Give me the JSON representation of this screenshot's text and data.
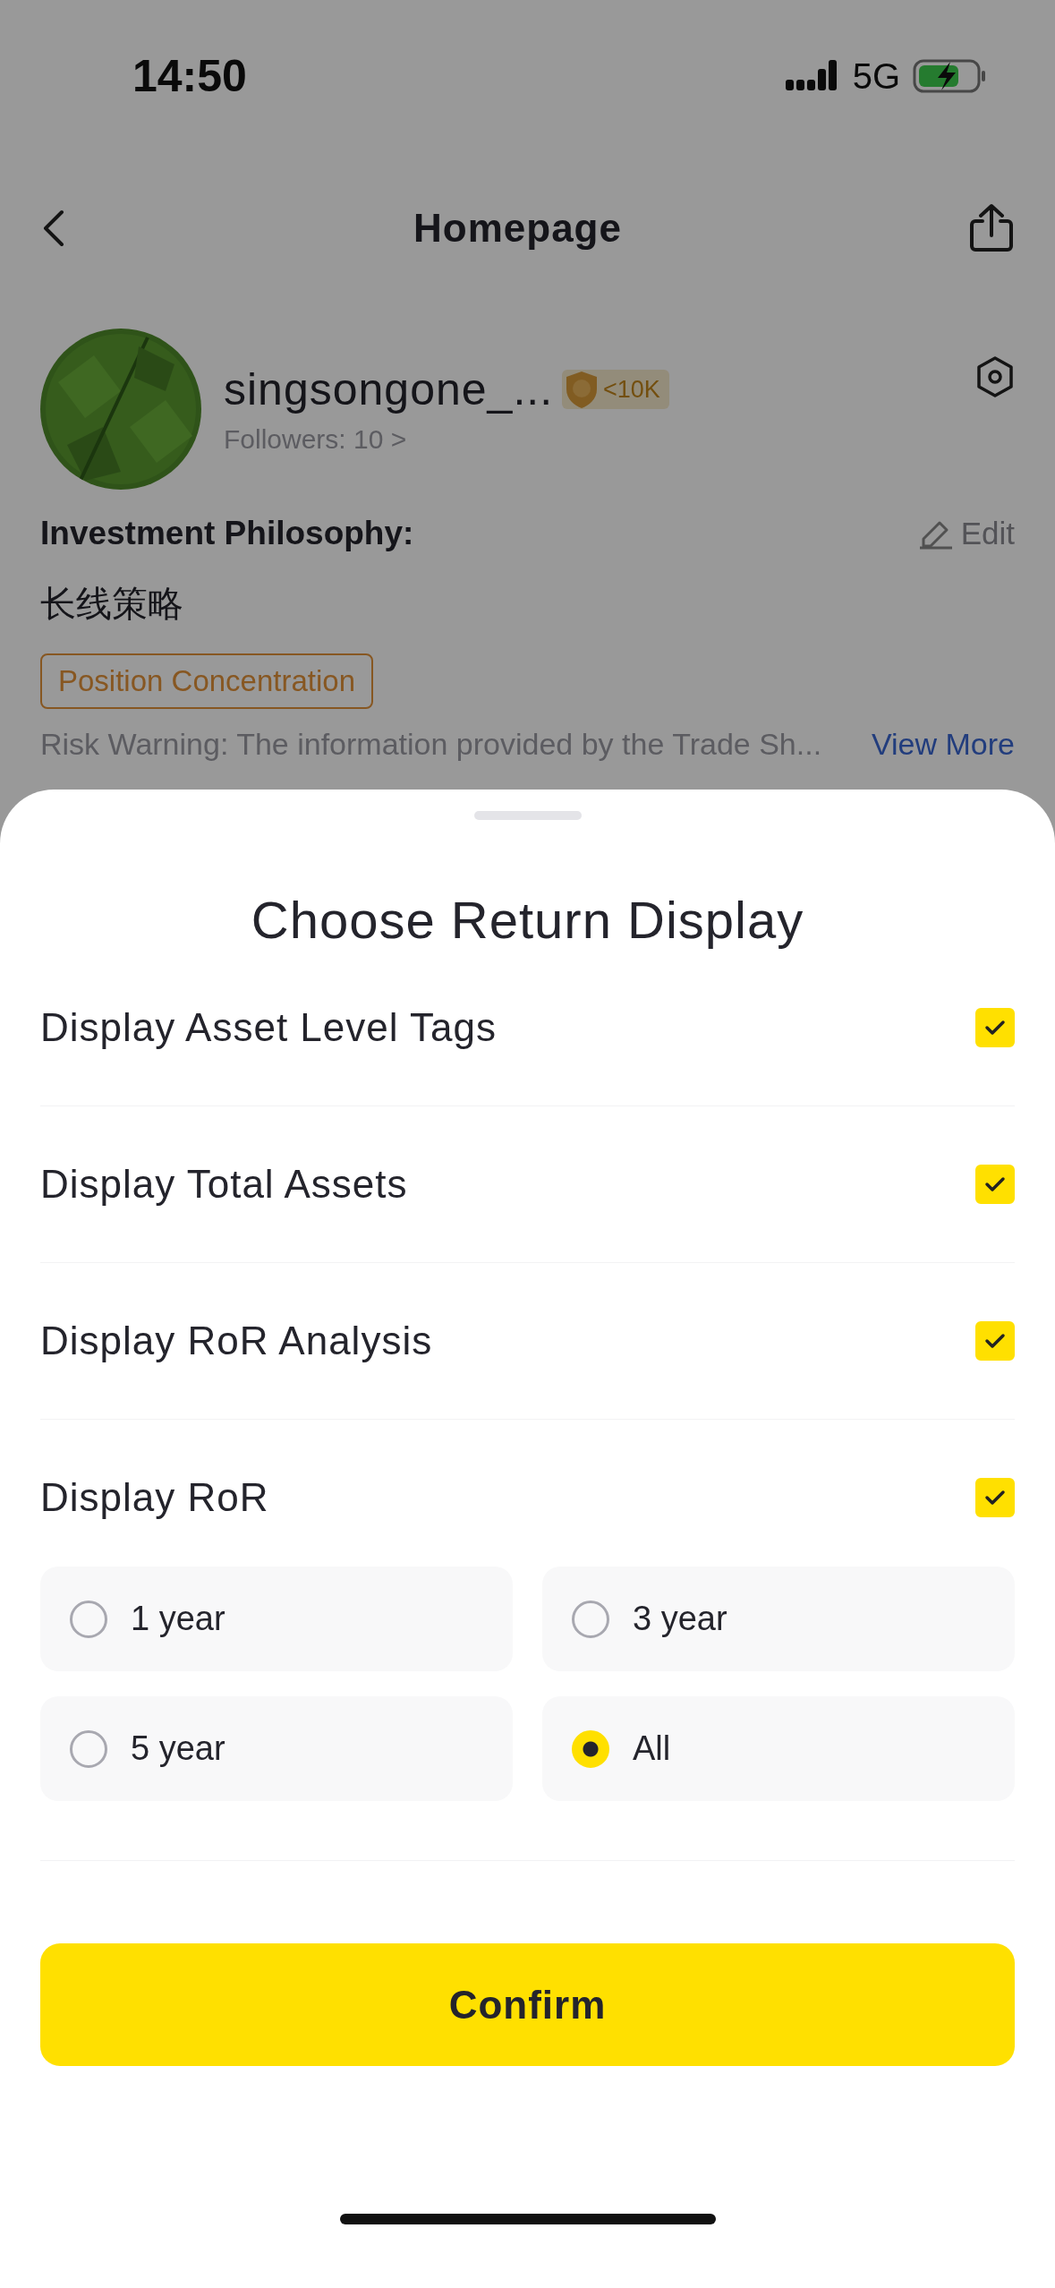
{
  "status_bar": {
    "time": "14:50",
    "network": "5G"
  },
  "header": {
    "title": "Homepage"
  },
  "profile": {
    "name": "singsongone_...",
    "badge": "<10K",
    "followers": "Followers: 10 >"
  },
  "philosophy": {
    "label": "Investment Philosophy:",
    "edit": "Edit",
    "text": "长线策略",
    "tags": [
      "Position Concentration"
    ]
  },
  "risk_warning": {
    "text": "Risk Warning: The information provided by the Trade Sh...",
    "link": "View More"
  },
  "sheet": {
    "title": "Choose Return Display",
    "options": [
      {
        "label": "Display Asset Level Tags",
        "checked": true
      },
      {
        "label": "Display Total Assets",
        "checked": true
      },
      {
        "label": "Display RoR Analysis",
        "checked": true
      },
      {
        "label": "Display RoR",
        "checked": true
      }
    ],
    "periods": [
      {
        "label": "1 year",
        "selected": false
      },
      {
        "label": "3 year",
        "selected": false
      },
      {
        "label": "5 year",
        "selected": false
      },
      {
        "label": "All",
        "selected": true
      }
    ],
    "confirm": "Confirm"
  }
}
